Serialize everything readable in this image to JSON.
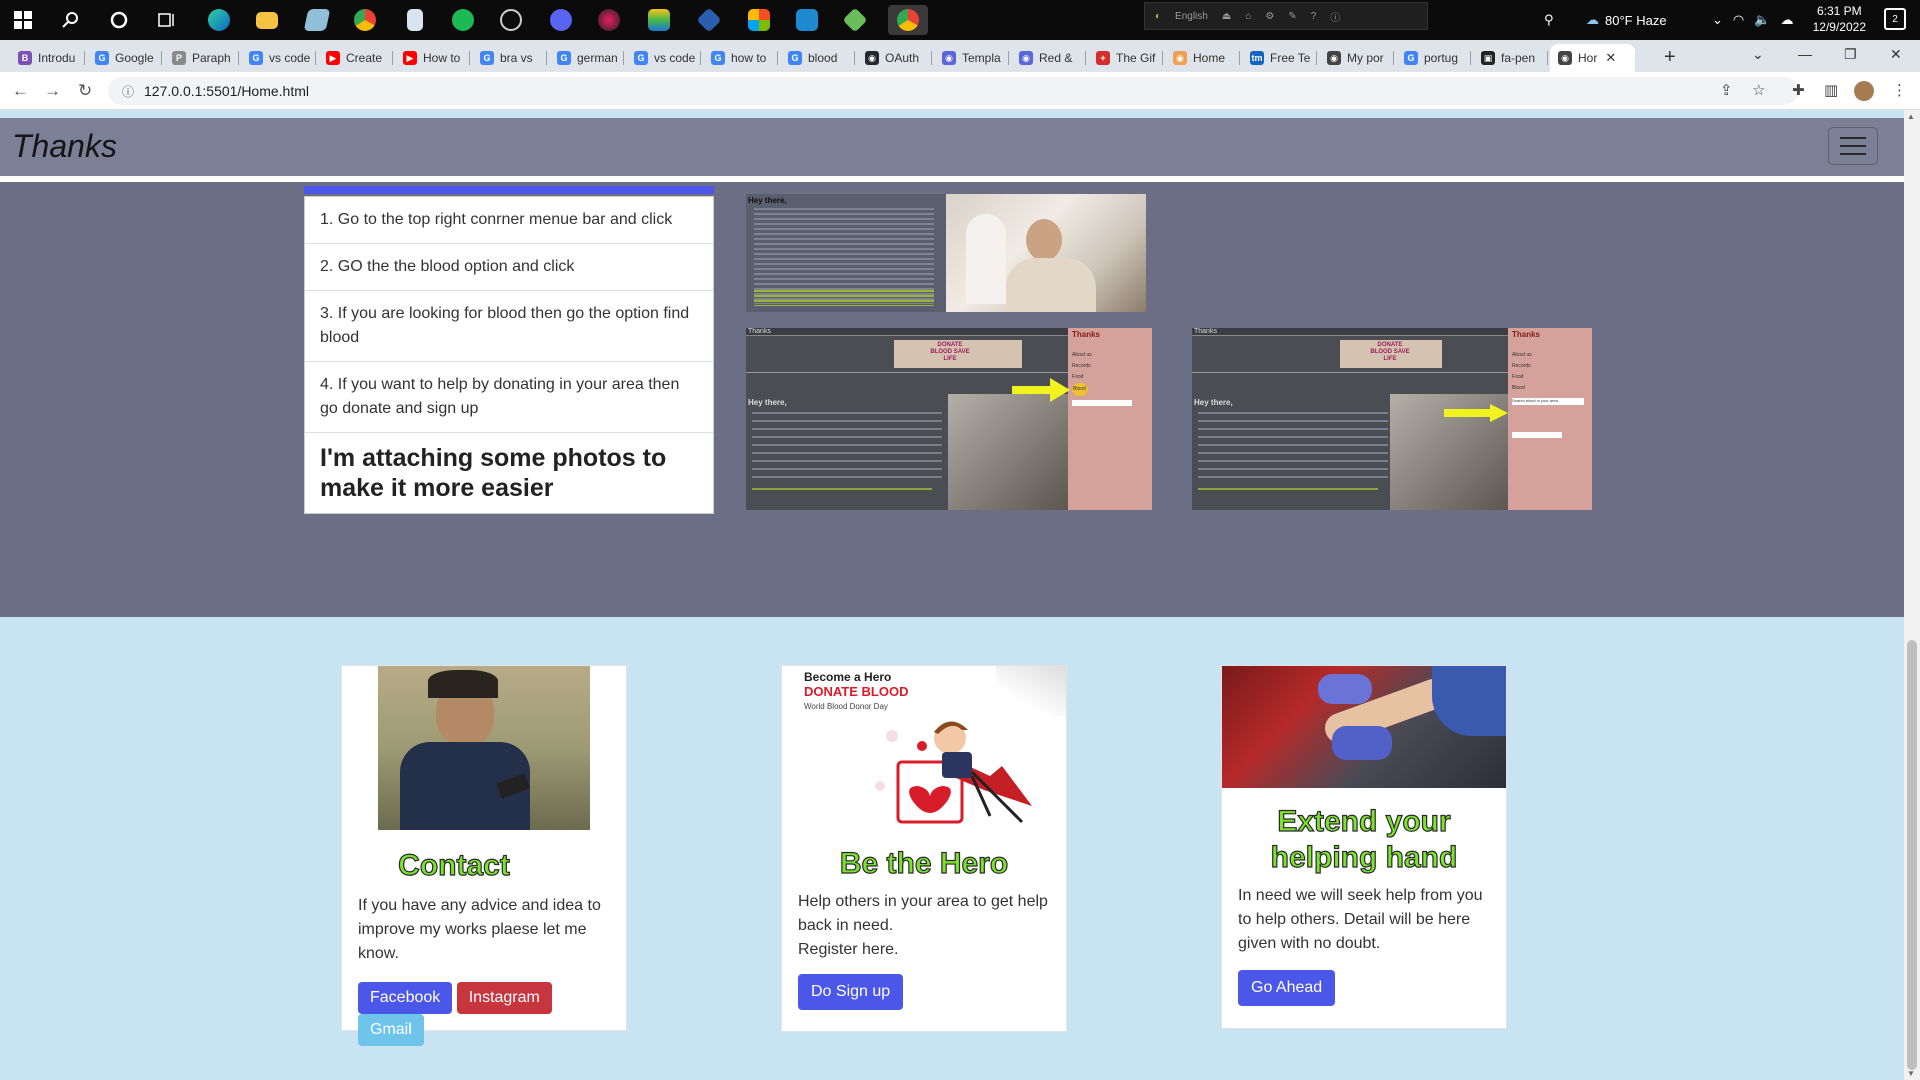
{
  "taskbar": {
    "lang": "English",
    "weather": "80°F  Haze",
    "time": "6:31 PM",
    "date": "12/9/2022",
    "notifications": "2"
  },
  "tabs": [
    {
      "label": "Introdu",
      "fav": "B",
      "color": "#7952b3"
    },
    {
      "label": "Google",
      "fav": "G",
      "color": "#4285f4"
    },
    {
      "label": "Paraph",
      "fav": "P",
      "color": "#8a8a8a"
    },
    {
      "label": "vs code",
      "fav": "G",
      "color": "#4285f4"
    },
    {
      "label": "Create",
      "fav": "▶",
      "color": "#ff0000"
    },
    {
      "label": "How to",
      "fav": "▶",
      "color": "#ff0000"
    },
    {
      "label": "bra vs",
      "fav": "G",
      "color": "#4285f4"
    },
    {
      "label": "german",
      "fav": "G",
      "color": "#4285f4"
    },
    {
      "label": "vs code",
      "fav": "G",
      "color": "#4285f4"
    },
    {
      "label": "how to",
      "fav": "G",
      "color": "#4285f4"
    },
    {
      "label": "blood",
      "fav": "G",
      "color": "#4285f4"
    },
    {
      "label": "OAuth",
      "fav": "◉",
      "color": "#24292f"
    },
    {
      "label": "Templa",
      "fav": "◉",
      "color": "#5a67d8"
    },
    {
      "label": "Red &",
      "fav": "◉",
      "color": "#5a67d8"
    },
    {
      "label": "The Gif",
      "fav": "+",
      "color": "#d32f2f"
    },
    {
      "label": "Home",
      "fav": "◉",
      "color": "#f0a050"
    },
    {
      "label": "Free Te",
      "fav": "tm",
      "color": "#1565c0"
    },
    {
      "label": "My por",
      "fav": "◉",
      "color": "#444"
    },
    {
      "label": "portug",
      "fav": "G",
      "color": "#4285f4"
    },
    {
      "label": "fa-pen",
      "fav": "▣",
      "color": "#222"
    },
    {
      "label": "Hor",
      "fav": "◉",
      "color": "#444"
    }
  ],
  "url": "127.0.0.1:5501/Home.html",
  "navbar": {
    "brand": "Thanks"
  },
  "steps": [
    "1. Go to the top right conrner menue bar and click",
    "2. GO the the blood option and click",
    "3. If you are looking for blood then go the option find blood",
    "4. If you want to help by donating in your area then go donate and sign up"
  ],
  "steps_footer": "I'm attaching some photos to make it more easier",
  "screenshots": {
    "greeting": "Hey there,",
    "mini_brand": "Thanks",
    "banner": "DONATE BLOOD SAVE LIFE",
    "menu_title": "Thanks",
    "menu_items": [
      "About us",
      "Records",
      "Food",
      "Blood"
    ],
    "search_hint": "Search blood in your area"
  },
  "cards": [
    {
      "title": "Contact",
      "text": "If you have any advice and idea to improve my works plaese let me know.",
      "buttons": [
        "Facebook",
        "Instagram",
        "Gmail"
      ]
    },
    {
      "title": "Be the Hero",
      "text": "Help others in your area to get help back in need.",
      "text2": "Register here.",
      "button": "Do Sign up",
      "poster": {
        "line1": "Become a Hero",
        "line2": "DONATE BLOOD",
        "line3": "World Blood Donor Day"
      }
    },
    {
      "title": "Extend your helping hand",
      "text": "In need we will seek help from you to help others. Detail will be here given with no doubt.",
      "button": "Go Ahead"
    }
  ]
}
